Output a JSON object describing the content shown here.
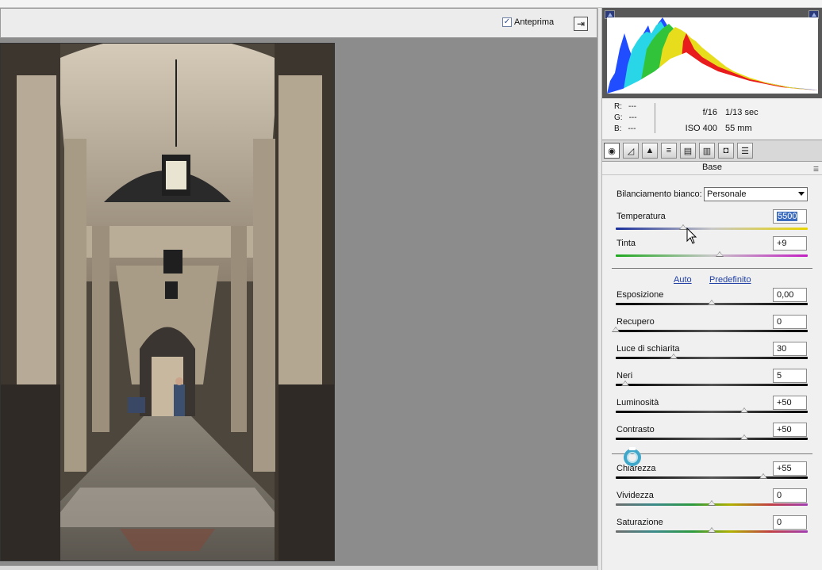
{
  "toolbar": {
    "preview_label": "Anteprima",
    "preview_checked": true
  },
  "histogram": {
    "channels": [
      "blue",
      "cyan",
      "green",
      "yellow",
      "red",
      "white"
    ]
  },
  "readout": {
    "r_label": "R:",
    "r_value": "---",
    "g_label": "G:",
    "g_value": "---",
    "b_label": "B:",
    "b_value": "---",
    "aperture": "f/16",
    "shutter": "1/13 sec",
    "iso": "ISO 400",
    "focal": "55 mm"
  },
  "tabs": [
    {
      "icon": "aperture-icon",
      "active": true
    },
    {
      "icon": "tone-curve-icon"
    },
    {
      "icon": "detail-icon"
    },
    {
      "icon": "hsl-icon"
    },
    {
      "icon": "split-toning-icon"
    },
    {
      "icon": "lens-corrections-icon"
    },
    {
      "icon": "camera-calibration-icon"
    },
    {
      "icon": "presets-icon"
    }
  ],
  "panel_title": "Base",
  "white_balance": {
    "label": "Bilanciamento bianco:",
    "value": "Personale"
  },
  "temp": {
    "label": "Temperatura",
    "value": "5500",
    "position": 0.35
  },
  "tint": {
    "label": "Tinta",
    "value": "+9",
    "position": 0.54
  },
  "auto_link": "Auto",
  "default_link": "Predefinito",
  "sliders": [
    {
      "key": "exposure",
      "label": "Esposizione",
      "value": "0,00",
      "position": 0.5
    },
    {
      "key": "recovery",
      "label": "Recupero",
      "value": "0",
      "position": 0.0
    },
    {
      "key": "fill",
      "label": "Luce di schiarita",
      "value": "30",
      "position": 0.3
    },
    {
      "key": "blacks",
      "label": "Neri",
      "value": "5",
      "position": 0.05
    },
    {
      "key": "brightness",
      "label": "Luminosità",
      "value": "+50",
      "position": 0.67
    },
    {
      "key": "contrast",
      "label": "Contrasto",
      "value": "+50",
      "position": 0.67
    },
    {
      "key": "clarity",
      "label": "Chiarezza",
      "value": "+55",
      "position": 0.77
    },
    {
      "key": "vibrance",
      "label": "Vividezza",
      "value": "0",
      "position": 0.5
    },
    {
      "key": "saturation",
      "label": "Saturazione",
      "value": "0",
      "position": 0.5
    }
  ],
  "colors": {
    "temp_track": "linear-gradient(90deg,#1a2f9a,#c8c8c8,#e8d400)",
    "tint_track": "linear-gradient(90deg,#1fa81f,#c8c8c8,#c21fc2)",
    "gray_track": "linear-gradient(90deg,#000,#555,#000)",
    "spectrum_track": "linear-gradient(90deg,#6d6d6d,#3a8a8a,#2c9a3e,#b0b000,#c04040,#a03cb0)"
  }
}
